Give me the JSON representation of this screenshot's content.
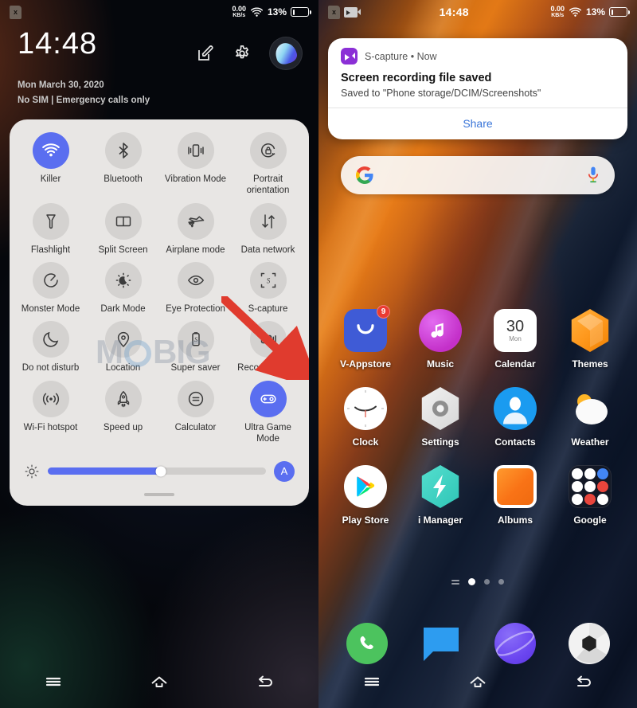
{
  "left": {
    "statusbar": {
      "sim_icon": "sim-card-x-icon",
      "network_speed_value": "0.00",
      "network_speed_unit": "KB/s",
      "wifi_icon": "wifi-icon",
      "battery_percent": "13%",
      "battery_level": 13
    },
    "header": {
      "clock": "14:48",
      "date": "Mon March 30, 2020",
      "sim_status": "No SIM | Emergency calls only",
      "edit_icon": "edit-icon",
      "settings_icon": "gear-icon",
      "avatar_icon": "user-avatar"
    },
    "quick_settings": {
      "tiles": [
        {
          "label": "Killer",
          "icon": "wifi-icon",
          "active": true
        },
        {
          "label": "Bluetooth",
          "icon": "bluetooth-icon",
          "active": false
        },
        {
          "label": "Vibration Mode",
          "icon": "vibration-icon",
          "active": false
        },
        {
          "label": "Portrait orientation",
          "icon": "rotation-lock-icon",
          "active": false
        },
        {
          "label": "Flashlight",
          "icon": "flashlight-icon",
          "active": false
        },
        {
          "label": "Split Screen",
          "icon": "split-screen-icon",
          "active": false
        },
        {
          "label": "Airplane mode",
          "icon": "airplane-icon",
          "active": false
        },
        {
          "label": "Data network",
          "icon": "data-network-icon",
          "active": false
        },
        {
          "label": "Monster Mode",
          "icon": "monster-mode-icon",
          "active": false
        },
        {
          "label": "Dark Mode",
          "icon": "dark-mode-icon",
          "active": false
        },
        {
          "label": "Eye Protection",
          "icon": "eye-protection-icon",
          "active": false
        },
        {
          "label": "S-capture",
          "icon": "screenshot-icon",
          "active": false
        },
        {
          "label": "Do not disturb",
          "icon": "moon-icon",
          "active": false
        },
        {
          "label": "Location",
          "icon": "location-pin-icon",
          "active": false
        },
        {
          "label": "Super saver",
          "icon": "super-saver-icon",
          "active": false
        },
        {
          "label": "Record Screen",
          "icon": "record-screen-icon",
          "active": false
        },
        {
          "label": "Wi-Fi hotspot",
          "icon": "hotspot-icon",
          "active": false
        },
        {
          "label": "Speed up",
          "icon": "rocket-icon",
          "active": false
        },
        {
          "label": "Calculator",
          "icon": "calculator-icon",
          "active": false
        },
        {
          "label": "Ultra Game Mode",
          "icon": "game-mode-icon",
          "active": true
        }
      ],
      "brightness": {
        "icon": "brightness-icon",
        "value_percent": 52,
        "auto_label": "A"
      },
      "accent_color": "#5a6ef0",
      "card_color": "#e8e6e4"
    },
    "watermark": {
      "text_before": "M",
      "text_after": "BIG"
    },
    "annotation": {
      "arrow_color": "#e03b2e",
      "points_to": "Record Screen"
    },
    "navbar": {
      "recents_icon": "menu-icon",
      "home_icon": "home-icon",
      "back_icon": "back-icon"
    }
  },
  "right": {
    "statusbar": {
      "sim_icon": "sim-card-x-icon",
      "recording_icon": "screen-record-icon",
      "time": "14:48",
      "network_speed_value": "0.00",
      "network_speed_unit": "KB/s",
      "wifi_icon": "wifi-icon",
      "battery_percent": "13%",
      "battery_level": 13
    },
    "notification": {
      "app_icon": "s-capture-icon",
      "app_name": "S-capture",
      "separator": "•",
      "time": "Now",
      "title": "Screen recording file saved",
      "subtitle": "Saved to \"Phone storage/DCIM/Screenshots\"",
      "action_label": "Share",
      "action_color": "#3874d8"
    },
    "search_widget": {
      "google_icon": "google-g-icon",
      "mic_icon": "microphone-icon"
    },
    "apps": [
      {
        "label": "V-Appstore",
        "icon": "v-appstore-icon",
        "badge": "9"
      },
      {
        "label": "Music",
        "icon": "music-icon",
        "badge": ""
      },
      {
        "label": "Calendar",
        "icon": "calendar-icon",
        "badge": "",
        "day": "30",
        "weekday": "Mon"
      },
      {
        "label": "Themes",
        "icon": "themes-icon",
        "badge": ""
      },
      {
        "label": "Clock",
        "icon": "clock-icon",
        "badge": ""
      },
      {
        "label": "Settings",
        "icon": "settings-icon",
        "badge": ""
      },
      {
        "label": "Contacts",
        "icon": "contacts-icon",
        "badge": ""
      },
      {
        "label": "Weather",
        "icon": "weather-icon",
        "badge": ""
      },
      {
        "label": "Play Store",
        "icon": "play-store-icon",
        "badge": ""
      },
      {
        "label": "i Manager",
        "icon": "i-manager-icon",
        "badge": ""
      },
      {
        "label": "Albums",
        "icon": "albums-icon",
        "badge": ""
      },
      {
        "label": "Google",
        "icon": "google-folder-icon",
        "badge": ""
      }
    ],
    "page_indicator": {
      "total": 3,
      "active_index": 0
    },
    "dock": [
      {
        "label": "Phone",
        "icon": "phone-icon"
      },
      {
        "label": "Messages",
        "icon": "message-icon"
      },
      {
        "label": "Browser",
        "icon": "browser-icon"
      },
      {
        "label": "Camera",
        "icon": "camera-icon"
      }
    ],
    "navbar": {
      "recents_icon": "menu-icon",
      "home_icon": "home-icon",
      "back_icon": "back-icon"
    }
  }
}
